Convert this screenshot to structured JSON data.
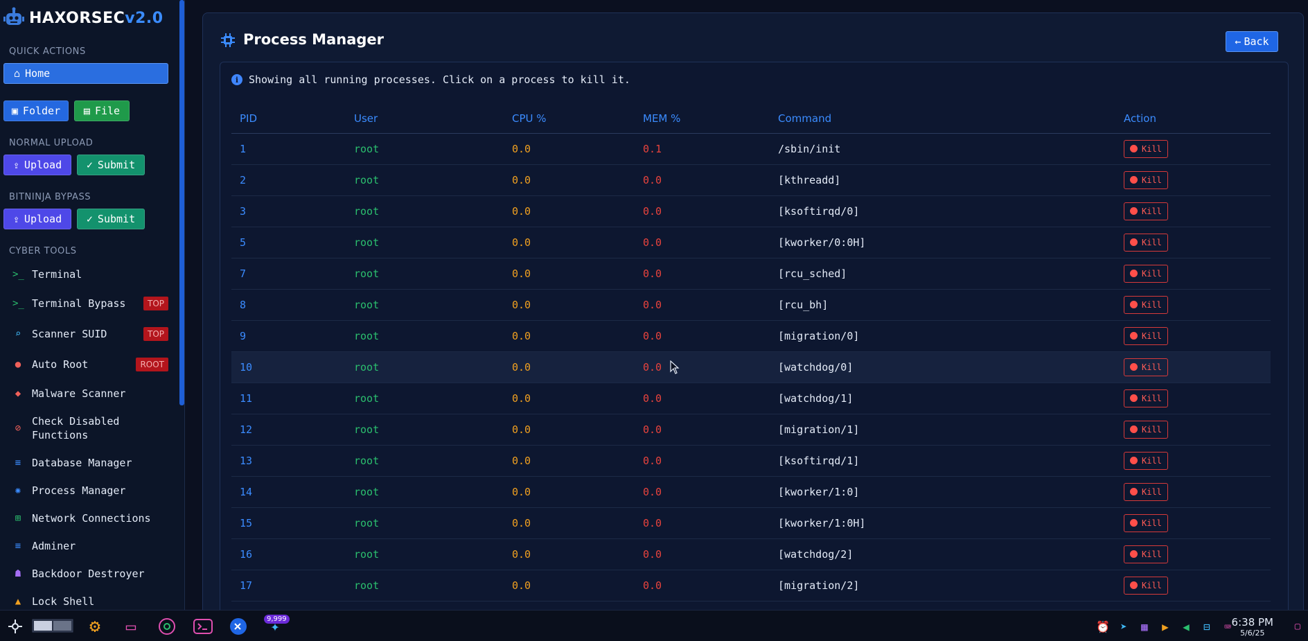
{
  "app": {
    "logo_main": "HAXORSEC",
    "logo_version": "v2.0"
  },
  "sidebar": {
    "quick_actions_title": "QUICK ACTIONS",
    "home_label": "Home",
    "folder_label": "Folder",
    "file_label": "File",
    "normal_upload_title": "NORMAL UPLOAD",
    "normal_upload_label": "Upload",
    "normal_submit_label": "Submit",
    "bitninja_title": "BITNINJA BYPASS",
    "bitninja_upload_label": "Upload",
    "bitninja_submit_label": "Submit",
    "cyber_tools_title": "CYBER TOOLS",
    "tools": [
      {
        "label": "Terminal",
        "icon": "terminal-icon",
        "tag": ""
      },
      {
        "label": "Terminal Bypass",
        "icon": "terminal-icon",
        "tag": "TOP"
      },
      {
        "label": "Scanner SUID",
        "icon": "search-icon",
        "tag": "TOP"
      },
      {
        "label": "Auto Root",
        "icon": "user-lock-icon",
        "tag": "ROOT"
      },
      {
        "label": "Malware Scanner",
        "icon": "shield-icon",
        "tag": ""
      },
      {
        "label": "Check Disabled Functions",
        "icon": "ban-icon",
        "tag": ""
      },
      {
        "label": "Database Manager",
        "icon": "database-icon",
        "tag": ""
      },
      {
        "label": "Process Manager",
        "icon": "cpu-icon",
        "tag": ""
      },
      {
        "label": "Network Connections",
        "icon": "network-icon",
        "tag": ""
      },
      {
        "label": "Adminer",
        "icon": "database-icon",
        "tag": ""
      },
      {
        "label": "Backdoor Destroyer",
        "icon": "ghost-icon",
        "tag": ""
      },
      {
        "label": "Lock Shell",
        "icon": "linux-icon",
        "tag": ""
      }
    ]
  },
  "main": {
    "title": "Process Manager",
    "back_label": "Back",
    "info_text": "Showing all running processes. Click on a process to kill it.",
    "columns": [
      "PID",
      "User",
      "CPU %",
      "MEM %",
      "Command",
      "Action"
    ],
    "kill_label": "Kill",
    "rows": [
      {
        "pid": "1",
        "user": "root",
        "cpu": "0.0",
        "mem": "0.1",
        "cmd": "/sbin/init"
      },
      {
        "pid": "2",
        "user": "root",
        "cpu": "0.0",
        "mem": "0.0",
        "cmd": "[kthreadd]"
      },
      {
        "pid": "3",
        "user": "root",
        "cpu": "0.0",
        "mem": "0.0",
        "cmd": "[ksoftirqd/0]"
      },
      {
        "pid": "5",
        "user": "root",
        "cpu": "0.0",
        "mem": "0.0",
        "cmd": "[kworker/0:0H]"
      },
      {
        "pid": "7",
        "user": "root",
        "cpu": "0.0",
        "mem": "0.0",
        "cmd": "[rcu_sched]"
      },
      {
        "pid": "8",
        "user": "root",
        "cpu": "0.0",
        "mem": "0.0",
        "cmd": "[rcu_bh]"
      },
      {
        "pid": "9",
        "user": "root",
        "cpu": "0.0",
        "mem": "0.0",
        "cmd": "[migration/0]"
      },
      {
        "pid": "10",
        "user": "root",
        "cpu": "0.0",
        "mem": "0.0",
        "cmd": "[watchdog/0]"
      },
      {
        "pid": "11",
        "user": "root",
        "cpu": "0.0",
        "mem": "0.0",
        "cmd": "[watchdog/1]"
      },
      {
        "pid": "12",
        "user": "root",
        "cpu": "0.0",
        "mem": "0.0",
        "cmd": "[migration/1]"
      },
      {
        "pid": "13",
        "user": "root",
        "cpu": "0.0",
        "mem": "0.0",
        "cmd": "[ksoftirqd/1]"
      },
      {
        "pid": "14",
        "user": "root",
        "cpu": "0.0",
        "mem": "0.0",
        "cmd": "[kworker/1:0]"
      },
      {
        "pid": "15",
        "user": "root",
        "cpu": "0.0",
        "mem": "0.0",
        "cmd": "[kworker/1:0H]"
      },
      {
        "pid": "16",
        "user": "root",
        "cpu": "0.0",
        "mem": "0.0",
        "cmd": "[watchdog/2]"
      },
      {
        "pid": "17",
        "user": "root",
        "cpu": "0.0",
        "mem": "0.0",
        "cmd": "[migration/2]"
      }
    ]
  },
  "taskbar": {
    "badge": "9,999",
    "time": "6:38 PM",
    "date": "5/6/25"
  }
}
